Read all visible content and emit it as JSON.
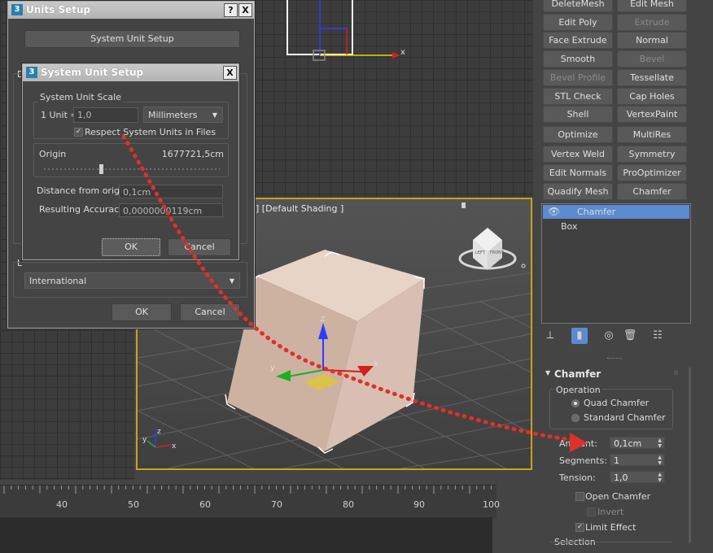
{
  "colors": {
    "selection": "#5b8ad0",
    "viewport_border": "#c9a21c",
    "arrow": "#e0302a",
    "box": "#d9c2b5"
  },
  "modifier_buttons": [
    {
      "label": "DeleteMesh",
      "enabled": true
    },
    {
      "label": "Edit Mesh",
      "enabled": true
    },
    {
      "label": "Edit Poly",
      "enabled": true
    },
    {
      "label": "Extrude",
      "enabled": false
    },
    {
      "label": "Face Extrude",
      "enabled": true
    },
    {
      "label": "Normal",
      "enabled": true
    },
    {
      "label": "Smooth",
      "enabled": true
    },
    {
      "label": "Bevel",
      "enabled": false
    },
    {
      "label": "Bevel Profile",
      "enabled": false
    },
    {
      "label": "Tessellate",
      "enabled": true
    },
    {
      "label": "STL Check",
      "enabled": true
    },
    {
      "label": "Cap Holes",
      "enabled": true
    },
    {
      "label": "Shell",
      "enabled": true
    },
    {
      "label": "VertexPaint",
      "enabled": true
    },
    {
      "label": "Optimize",
      "enabled": true
    },
    {
      "label": "MultiRes",
      "enabled": true
    },
    {
      "label": "Vertex Weld",
      "enabled": true
    },
    {
      "label": "Symmetry",
      "enabled": true
    },
    {
      "label": "Edit Normals",
      "enabled": true
    },
    {
      "label": "ProOptimizer",
      "enabled": true
    },
    {
      "label": "Quadify Mesh",
      "enabled": true
    },
    {
      "label": "Chamfer",
      "enabled": true
    }
  ],
  "stack": {
    "items": [
      "Chamfer",
      "Box"
    ],
    "selected": "Chamfer"
  },
  "stack_toolbar_icons": [
    "pin-icon",
    "show-end-result-icon",
    "make-unique-icon",
    "remove-modifier-icon",
    "configure-modifier-sets-icon"
  ],
  "rollout": {
    "title": "Chamfer",
    "operation_label": "Operation",
    "operations": [
      {
        "label": "Quad Chamfer",
        "selected": true
      },
      {
        "label": "Standard Chamfer",
        "selected": false
      }
    ],
    "amount_label": "Amount:",
    "amount_value": "0,1cm",
    "segments_label": "Segments:",
    "segments_value": "1",
    "tension_label": "Tension:",
    "tension_value": "1,0",
    "open_chamfer_label": "Open Chamfer",
    "open_chamfer_checked": false,
    "invert_label": "Invert",
    "limit_effect_label": "Limit Effect",
    "limit_effect_checked": true,
    "selection_label": "Selection"
  },
  "viewport": {
    "label": "] [Default Shading ]",
    "axis_labels": {
      "x": "x",
      "y": "y",
      "z": "z"
    },
    "viewcube_labels": {
      "left": "LEFT",
      "front": "FRONT"
    }
  },
  "ruler": {
    "ticks": [
      "40",
      "50",
      "60",
      "70",
      "80",
      "90",
      "100"
    ]
  },
  "units_setup": {
    "title": "Units Setup",
    "help_btn": "?",
    "close_btn": "X",
    "system_unit_setup_btn": "System Unit Setup",
    "partial_label_d": "D",
    "partial_label_l": "L",
    "lighting_units_value": "International",
    "ok_label": "OK",
    "cancel_label": "Cancel"
  },
  "system_unit_setup": {
    "title": "System Unit Setup",
    "close_btn": "X",
    "scale_group_label": "System Unit Scale",
    "one_unit_label": "1 Unit =",
    "one_unit_value": "1,0",
    "units_value": "Millimeters",
    "respect_label": "Respect System Units in Files",
    "respect_checked": true,
    "origin_label": "Origin",
    "origin_value": "1677721,5cm",
    "distance_label": "Distance from origin:",
    "distance_value": "0,1cm",
    "accuracy_label": "Resulting Accuracy:",
    "accuracy_value": "0,0000000119cm",
    "ok_label": "OK",
    "cancel_label": "Cancel"
  }
}
